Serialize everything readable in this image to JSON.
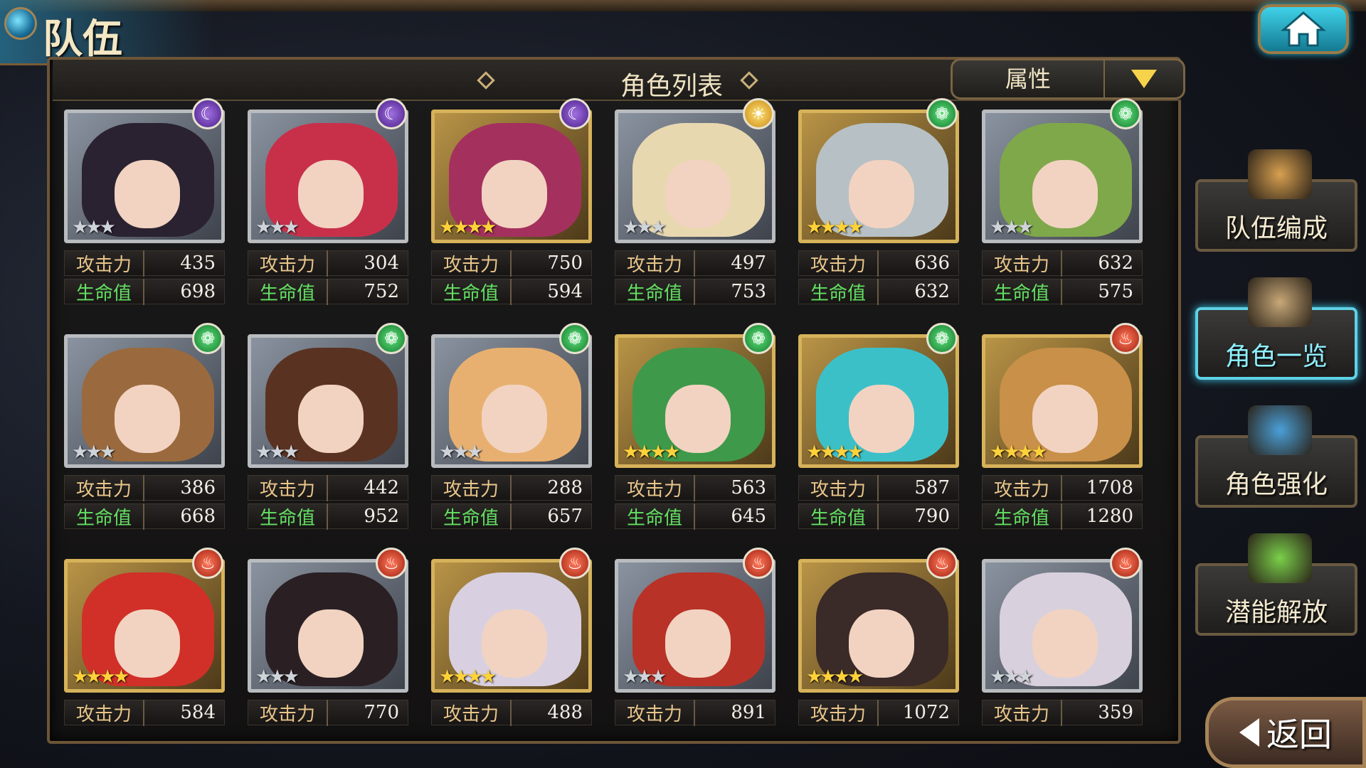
{
  "header": {
    "screen_title": "队伍",
    "list_title": "角色列表",
    "filter_label": "属性",
    "home_icon": "home-icon"
  },
  "stat_labels": {
    "attack": "攻击力",
    "hp": "生命值"
  },
  "characters": [
    {
      "element": "moon",
      "rarity": 3,
      "frame": "silver",
      "attack": "435",
      "hp": "698",
      "art_color": "#2a2230"
    },
    {
      "element": "moon",
      "rarity": 3,
      "frame": "silver",
      "attack": "304",
      "hp": "752",
      "art_color": "#c8304a"
    },
    {
      "element": "moon",
      "rarity": 4,
      "frame": "gold",
      "attack": "750",
      "hp": "594",
      "art_color": "#a4305e"
    },
    {
      "element": "sun",
      "rarity": 3,
      "frame": "silver",
      "attack": "497",
      "hp": "753",
      "art_color": "#e8d8b0"
    },
    {
      "element": "wind",
      "rarity": 4,
      "frame": "gold",
      "attack": "636",
      "hp": "632",
      "art_color": "#b7c0c4"
    },
    {
      "element": "wind",
      "rarity": 3,
      "frame": "silver",
      "attack": "632",
      "hp": "575",
      "art_color": "#7fa84a"
    },
    {
      "element": "wind",
      "rarity": 3,
      "frame": "silver",
      "attack": "386",
      "hp": "668",
      "art_color": "#9a6a3e"
    },
    {
      "element": "wind",
      "rarity": 3,
      "frame": "silver",
      "attack": "442",
      "hp": "952",
      "art_color": "#5a3222"
    },
    {
      "element": "wind",
      "rarity": 3,
      "frame": "silver",
      "attack": "288",
      "hp": "657",
      "art_color": "#e8b070"
    },
    {
      "element": "wind",
      "rarity": 4,
      "frame": "gold",
      "attack": "563",
      "hp": "645",
      "art_color": "#3e9a4a"
    },
    {
      "element": "wind",
      "rarity": 4,
      "frame": "gold",
      "attack": "587",
      "hp": "790",
      "art_color": "#3cc0c8"
    },
    {
      "element": "fire",
      "rarity": 4,
      "frame": "gold",
      "attack": "1708",
      "hp": "1280",
      "art_color": "#c89048"
    },
    {
      "element": "fire",
      "rarity": 4,
      "frame": "gold",
      "attack": "584",
      "hp": "",
      "art_color": "#d03028"
    },
    {
      "element": "fire",
      "rarity": 3,
      "frame": "silver",
      "attack": "770",
      "hp": "",
      "art_color": "#2a2024"
    },
    {
      "element": "fire",
      "rarity": 4,
      "frame": "gold",
      "attack": "488",
      "hp": "",
      "art_color": "#d8d0e0"
    },
    {
      "element": "fire",
      "rarity": 3,
      "frame": "silver",
      "attack": "891",
      "hp": "",
      "art_color": "#b83228"
    },
    {
      "element": "fire",
      "rarity": 4,
      "frame": "gold",
      "attack": "1072",
      "hp": "",
      "art_color": "#3a2a28"
    },
    {
      "element": "fire",
      "rarity": 3,
      "frame": "silver",
      "attack": "359",
      "hp": "",
      "art_color": "#d8d0dc"
    }
  ],
  "side_menu": [
    {
      "label": "队伍编成",
      "icon": "team-formation-icon",
      "active": false,
      "icon_color": "#d8a050"
    },
    {
      "label": "角色一览",
      "icon": "character-book-icon",
      "active": true,
      "icon_color": "#c8a878"
    },
    {
      "label": "角色强化",
      "icon": "enhance-crystal-icon",
      "active": false,
      "icon_color": "#4aa0d8"
    },
    {
      "label": "潜能解放",
      "icon": "potential-orb-icon",
      "active": false,
      "icon_color": "#7ad04a"
    }
  ],
  "back_button": {
    "label": "返回",
    "icon": "back-arrow-icon"
  }
}
